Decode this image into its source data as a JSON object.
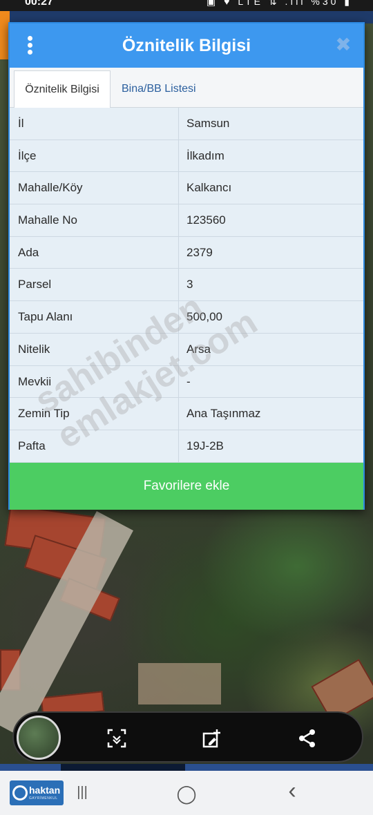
{
  "status_bar": {
    "time": "00:27",
    "icons": "▣ ♥ LTE ⇅ .ıll %30 ▮"
  },
  "dialog": {
    "title": "Öznitelik Bilgisi",
    "close_glyph": "✖",
    "tabs": [
      {
        "label": "Öznitelik Bilgisi",
        "active": true
      },
      {
        "label": "Bina/BB Listesi",
        "active": false
      }
    ],
    "rows": [
      {
        "key": "İl",
        "value": "Samsun"
      },
      {
        "key": "İlçe",
        "value": "İlkadım"
      },
      {
        "key": "Mahalle/Köy",
        "value": "Kalkancı"
      },
      {
        "key": "Mahalle No",
        "value": "123560"
      },
      {
        "key": "Ada",
        "value": "2379"
      },
      {
        "key": "Parsel",
        "value": "3"
      },
      {
        "key": "Tapu Alanı",
        "value": "500,00"
      },
      {
        "key": "Nitelik",
        "value": "Arsa"
      },
      {
        "key": "Mevkii",
        "value": "-"
      },
      {
        "key": "Zemin Tip",
        "value": "Ana Taşınmaz"
      },
      {
        "key": "Pafta",
        "value": "19J-2B"
      }
    ],
    "favorite_button": "Favorilere ekle"
  },
  "watermark": "sahibinden emlakjet.com",
  "toolbar": {
    "icons": [
      "map-thumbnail",
      "scan-icon",
      "add-edit-icon",
      "share-icon"
    ]
  },
  "navbar": {
    "brand_name": "haktan",
    "brand_sub": "GAYRİMENKUL",
    "recent_glyph": "|||",
    "home_glyph": "◯",
    "back_glyph": "‹"
  },
  "colors": {
    "header_blue": "#3d98ef",
    "favorite_green": "#4ccd62",
    "row_bg": "#e6eff6"
  }
}
